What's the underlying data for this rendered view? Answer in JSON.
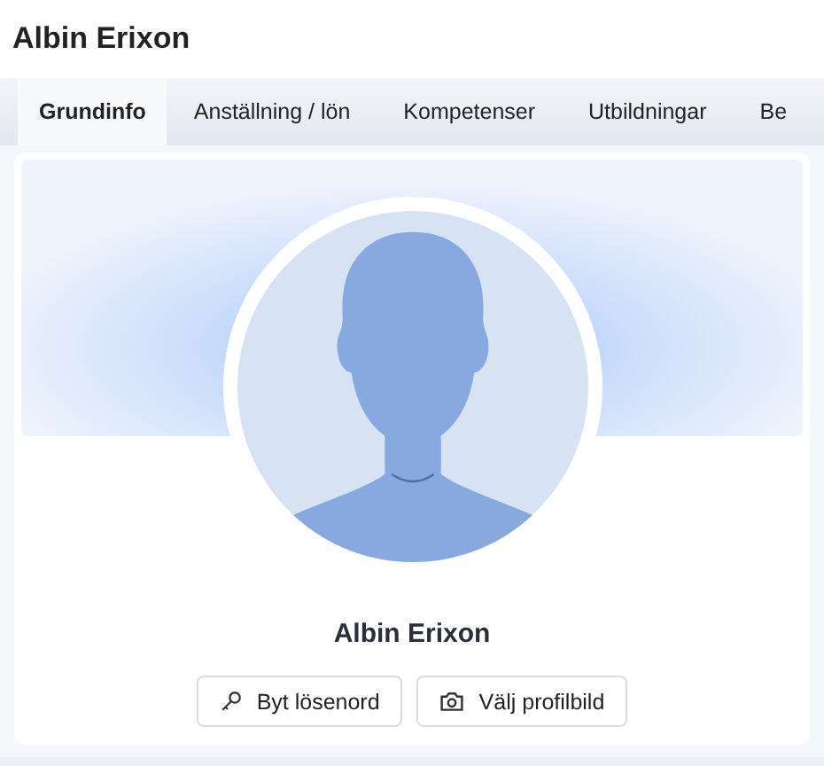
{
  "page": {
    "title": "Albin Erixon"
  },
  "tabs": [
    {
      "label": "Grundinfo",
      "selected": true
    },
    {
      "label": "Anställning / lön",
      "selected": false
    },
    {
      "label": "Kompetenser",
      "selected": false
    },
    {
      "label": "Utbildningar",
      "selected": false
    },
    {
      "label": "Be",
      "selected": false
    }
  ],
  "profile": {
    "name": "Albin Erixon",
    "buttons": [
      {
        "kind": "password",
        "label": "Byt lösenord"
      },
      {
        "kind": "photo",
        "label": "Välj profilbild"
      }
    ]
  }
}
